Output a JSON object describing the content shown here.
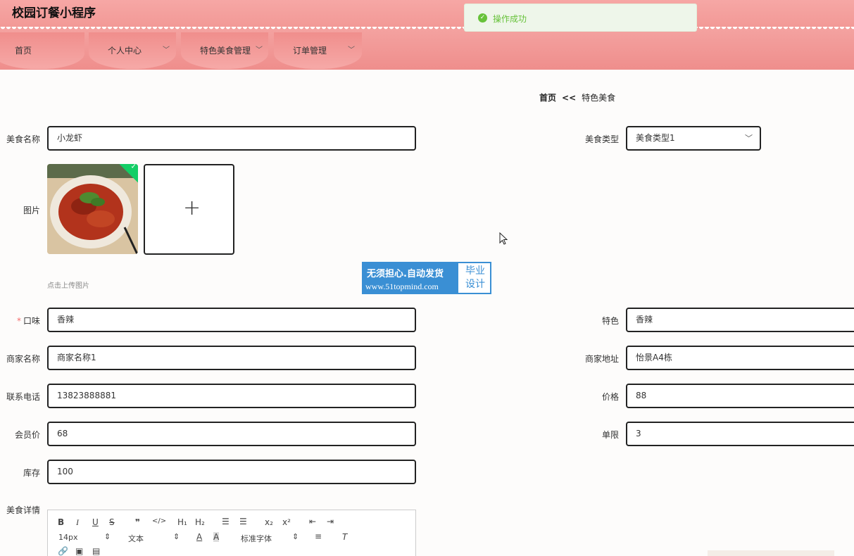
{
  "app": {
    "title": "校园订餐小程序"
  },
  "nav": {
    "tabs": [
      {
        "label": "首页"
      },
      {
        "label": "个人中心"
      },
      {
        "label": "特色美食管理"
      },
      {
        "label": "订单管理"
      }
    ]
  },
  "toast": {
    "message": "操作成功"
  },
  "breadcrumb": {
    "home": "首页",
    "sep": "<<",
    "current": "特色美食"
  },
  "form": {
    "food_name": {
      "label": "美食名称",
      "value": "小龙虾"
    },
    "food_type": {
      "label": "美食类型",
      "value": "美食类型1"
    },
    "image": {
      "label": "图片",
      "hint": "点击上传图片"
    },
    "taste": {
      "label": "口味",
      "required": "*",
      "value": "香辣"
    },
    "feature": {
      "label": "特色",
      "value": "香辣"
    },
    "merchant_name": {
      "label": "商家名称",
      "value": "商家名称1"
    },
    "merchant_address": {
      "label": "商家地址",
      "value": "怡景A4栋"
    },
    "phone": {
      "label": "联系电话",
      "value": "13823888881"
    },
    "price": {
      "label": "价格",
      "value": "88"
    },
    "member_price": {
      "label": "会员价",
      "value": "68"
    },
    "limit": {
      "label": "单限",
      "value": "3"
    },
    "stock": {
      "label": "库存",
      "value": "100"
    },
    "details": {
      "label": "美食详情"
    }
  },
  "editor": {
    "font_size": "14px",
    "header_select": "文本",
    "font_family": "标准字体"
  },
  "watermark": {
    "line1": "无须担心.自动发货",
    "line2": "www.51topmind.com",
    "right1": "毕业",
    "right2": "设计"
  },
  "colors": {
    "header": "#f29895",
    "success": "#67c23a",
    "watermark": "#3a8fd4"
  }
}
